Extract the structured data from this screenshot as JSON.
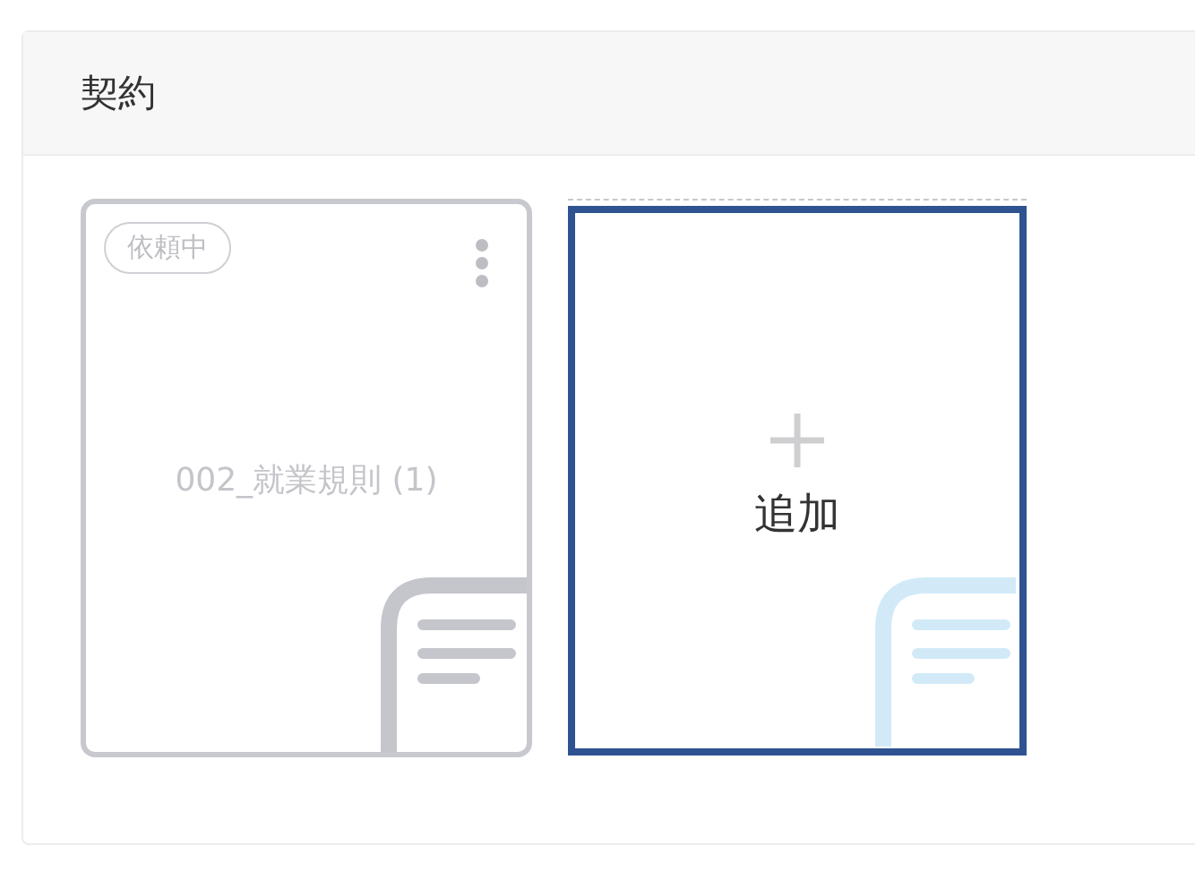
{
  "section": {
    "title": "契約"
  },
  "documents": [
    {
      "status": "依頼中",
      "name": "002_就業規則 (1)"
    }
  ],
  "add_card": {
    "label": "追加",
    "focused": true
  }
}
